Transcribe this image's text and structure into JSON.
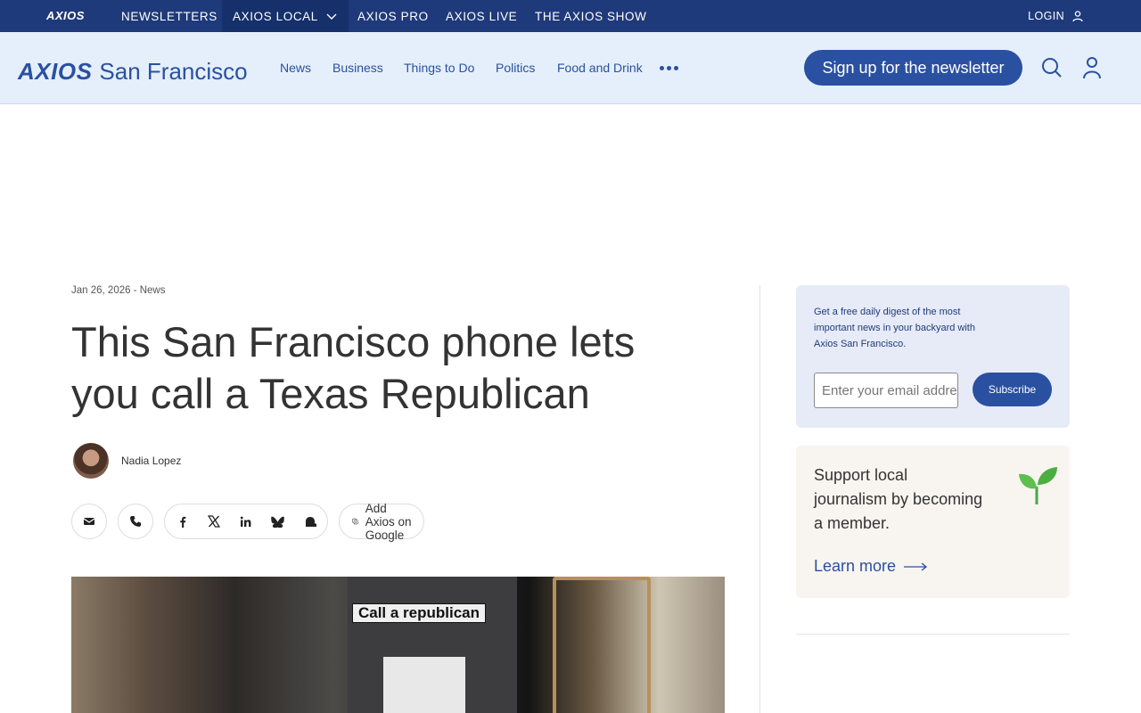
{
  "topnav": {
    "logo": "AXIOS",
    "items": [
      "NEWSLETTERS",
      "AXIOS LOCAL",
      "AXIOS PRO",
      "AXIOS LIVE",
      "THE AXIOS SHOW"
    ],
    "login": "LOGIN"
  },
  "local": {
    "brand": "AXIOS",
    "city": "San Francisco",
    "sections": [
      "News",
      "Business",
      "Things to Do",
      "Politics",
      "Food and Drink"
    ],
    "signup": "Sign up for the newsletter"
  },
  "article": {
    "meta": "Jan 26, 2026 - News",
    "headline": "This San Francisco phone lets you call a Texas Republican",
    "author": "Nadia Lopez",
    "google": "Add Axios on Google",
    "photo_sign": "Call a republican"
  },
  "sidebar": {
    "desc": "Get a free daily digest of the most important news in your backyard with Axios San Francisco.",
    "email_placeholder": "Enter your email address",
    "subscribe": "Subscribe",
    "member_text": "Support local journalism by becoming a member.",
    "learn_more": "Learn more"
  },
  "colors": {
    "navy": "#1f3a7a",
    "brand_blue": "#2a50a1",
    "light_blue": "#e5effb"
  }
}
